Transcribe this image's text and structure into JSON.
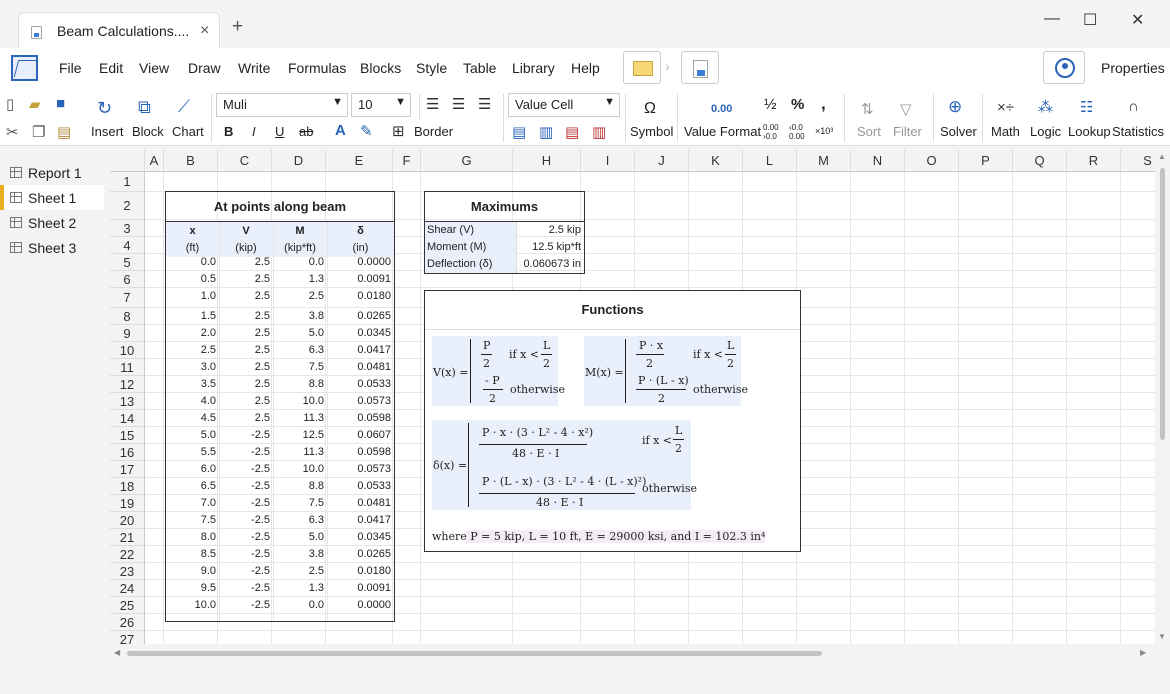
{
  "window": {
    "tab_title": "Beam Calculations....",
    "new_tab": "+",
    "minimize": "—",
    "maximize": "☐",
    "close": "✕",
    "tab_close": "×"
  },
  "menu": {
    "items": [
      "File",
      "Edit",
      "View",
      "Draw",
      "Write",
      "Formulas",
      "Blocks",
      "Style",
      "Table",
      "Library",
      "Help"
    ],
    "properties": "Properties"
  },
  "toolbar": {
    "insert": "Insert",
    "block": "Block",
    "chart": "Chart",
    "font": "Muli",
    "size": "10",
    "cell_type": "Value Cell",
    "border": "Border",
    "symbol": "Symbol",
    "value_format": "Value Format",
    "value_format_sample": "0.00",
    "sort": "Sort",
    "filter": "Filter",
    "solver": "Solver",
    "math": "Math",
    "logic": "Logic",
    "lookup": "Lookup",
    "statistics": "Statistics",
    "bold": "B",
    "italic": "I",
    "underline": "U",
    "strike": "ab",
    "fraction": "½",
    "percent": "%",
    "comma": ",",
    "dec_inc": "0.00 ›0.0",
    "dec_dec": "‹0.0 0.00",
    "sci": "×10³",
    "symbol_glyph": "Ω",
    "font_color": "A"
  },
  "sheets": [
    {
      "label": "Report 1",
      "type": "report"
    },
    {
      "label": "Sheet 1",
      "type": "sheet",
      "active": true
    },
    {
      "label": "Sheet 2",
      "type": "sheet"
    },
    {
      "label": "Sheet 3",
      "type": "sheet"
    }
  ],
  "columns": [
    "A",
    "B",
    "C",
    "D",
    "E",
    "F",
    "G",
    "H",
    "I",
    "J",
    "K",
    "L",
    "M",
    "N",
    "O",
    "P",
    "Q",
    "R",
    "S"
  ],
  "rows": [
    "1",
    "2",
    "3",
    "4",
    "5",
    "6",
    "7",
    "8",
    "9",
    "10",
    "11",
    "12",
    "13",
    "14",
    "15",
    "16",
    "17",
    "18",
    "19",
    "20",
    "21",
    "22",
    "23",
    "24",
    "25",
    "26",
    "27"
  ],
  "beam_table": {
    "title": "At points along beam",
    "headers": [
      "x",
      "V",
      "M",
      "δ"
    ],
    "units": [
      "(ft)",
      "(kip)",
      "(kip*ft)",
      "(in)"
    ],
    "rows": [
      [
        "0.0",
        "2.5",
        "0.0",
        "0.0000"
      ],
      [
        "0.5",
        "2.5",
        "1.3",
        "0.0091"
      ],
      [
        "1.0",
        "2.5",
        "2.5",
        "0.0180"
      ],
      [
        "1.5",
        "2.5",
        "3.8",
        "0.0265"
      ],
      [
        "2.0",
        "2.5",
        "5.0",
        "0.0345"
      ],
      [
        "2.5",
        "2.5",
        "6.3",
        "0.0417"
      ],
      [
        "3.0",
        "2.5",
        "7.5",
        "0.0481"
      ],
      [
        "3.5",
        "2.5",
        "8.8",
        "0.0533"
      ],
      [
        "4.0",
        "2.5",
        "10.0",
        "0.0573"
      ],
      [
        "4.5",
        "2.5",
        "11.3",
        "0.0598"
      ],
      [
        "5.0",
        "-2.5",
        "12.5",
        "0.0607"
      ],
      [
        "5.5",
        "-2.5",
        "11.3",
        "0.0598"
      ],
      [
        "6.0",
        "-2.5",
        "10.0",
        "0.0573"
      ],
      [
        "6.5",
        "-2.5",
        "8.8",
        "0.0533"
      ],
      [
        "7.0",
        "-2.5",
        "7.5",
        "0.0481"
      ],
      [
        "7.5",
        "-2.5",
        "6.3",
        "0.0417"
      ],
      [
        "8.0",
        "-2.5",
        "5.0",
        "0.0345"
      ],
      [
        "8.5",
        "-2.5",
        "3.8",
        "0.0265"
      ],
      [
        "9.0",
        "-2.5",
        "2.5",
        "0.0180"
      ],
      [
        "9.5",
        "-2.5",
        "1.3",
        "0.0091"
      ],
      [
        "10.0",
        "-2.5",
        "0.0",
        "0.0000"
      ]
    ]
  },
  "maximums": {
    "title": "Maximums",
    "rows": [
      {
        "label": "Shear (V)",
        "value": "2.5 kip"
      },
      {
        "label": "Moment (M)",
        "value": "12.5 kip*ft"
      },
      {
        "label": "Deflection (δ)",
        "value": "0.060673 in"
      }
    ]
  },
  "functions": {
    "title": "Functions",
    "V": {
      "lhs": "V(x) =",
      "p1n": "P",
      "p1d": "2",
      "c1": "if x <",
      "c1n": "L",
      "c1d": "2",
      "p2n": "- P",
      "p2d": "2",
      "c2": "otherwise"
    },
    "M": {
      "lhs": "M(x) =",
      "p1n": "P · x",
      "p1d": "2",
      "c1": "if x <",
      "c1n": "L",
      "c1d": "2",
      "p2n": "P · (L - x)",
      "p2d": "2",
      "c2": "otherwise"
    },
    "D": {
      "lhs": "δ(x) =",
      "p1n": "P · x · (3 · L² - 4 · x²)",
      "p1d": "48 · E · I",
      "c1": "if x <",
      "c1n": "L",
      "c1d": "2",
      "p2n": "P · (L - x) · (3 · L² - 4 · (L - x)²)",
      "p2d": "48 · E · I",
      "c2": "otherwise"
    },
    "where": "where P = 5 kip, L = 10 ft, E = 29000 ksi, and I = 102.3 in⁴"
  }
}
